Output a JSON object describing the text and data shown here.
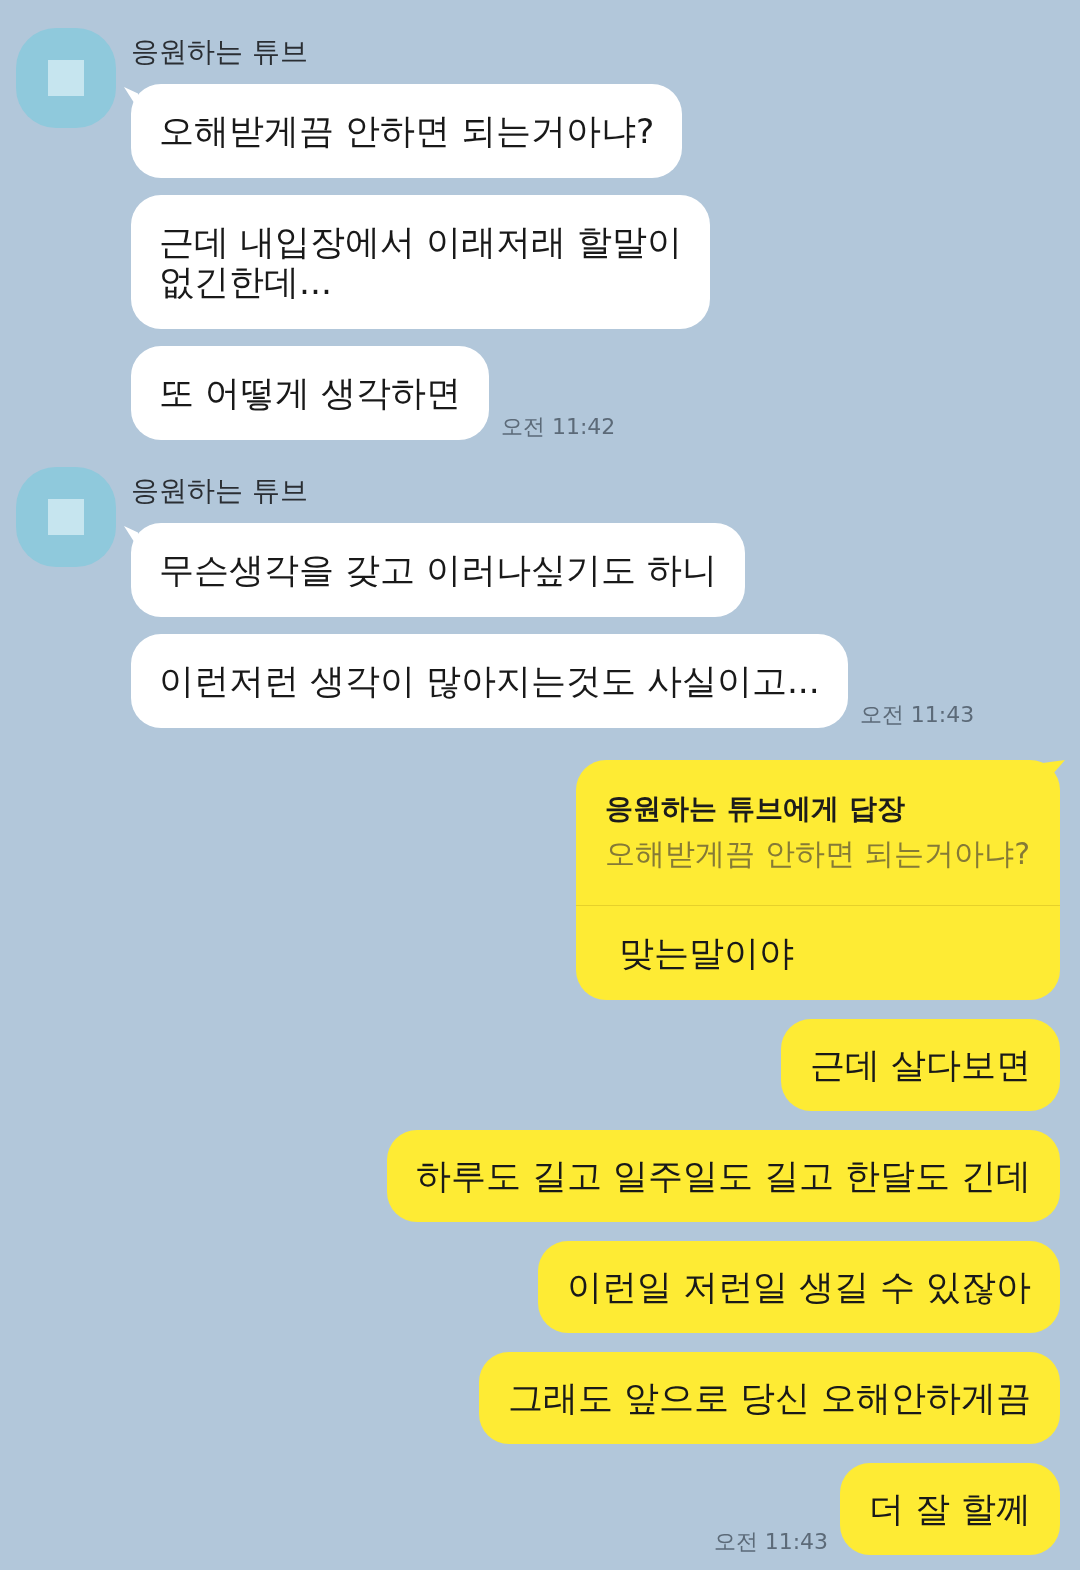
{
  "conversation": [
    {
      "kind": "received",
      "sender": "응원하는 튜브",
      "messages": [
        {
          "kind": "text",
          "text": "오해받게끔 안하면 되는거아냐?"
        },
        {
          "kind": "text",
          "text": "근데 내입장에서 이래저래 할말이\n없긴한데..."
        },
        {
          "kind": "text",
          "text": "또 어떻게 생각하면"
        }
      ],
      "time": "오전 11:42"
    },
    {
      "kind": "received",
      "sender": "응원하는 튜브",
      "messages": [
        {
          "kind": "text",
          "text": "무슨생각을 갖고 이러나싶기도 하니"
        },
        {
          "kind": "text",
          "text": "이런저런 생각이 많아지는것도 사실이고..."
        }
      ],
      "time": "오전 11:43"
    },
    {
      "kind": "sent",
      "messages": [
        {
          "kind": "reply",
          "reply_label": "응원하는 튜브에게 답장",
          "quoted": "오해받게끔 안하면 되는거아냐?",
          "text": "맞는말이야"
        },
        {
          "kind": "text",
          "text": "근데 살다보면"
        },
        {
          "kind": "text",
          "text": "하루도 길고 일주일도 길고 한달도 긴데"
        },
        {
          "kind": "text",
          "text": "이런일 저런일 생길 수 있잖아"
        },
        {
          "kind": "text",
          "text": "그래도 앞으로 당신 오해안하게끔"
        },
        {
          "kind": "text",
          "text": "더 잘 할께"
        }
      ],
      "time": "오전 11:43"
    }
  ]
}
